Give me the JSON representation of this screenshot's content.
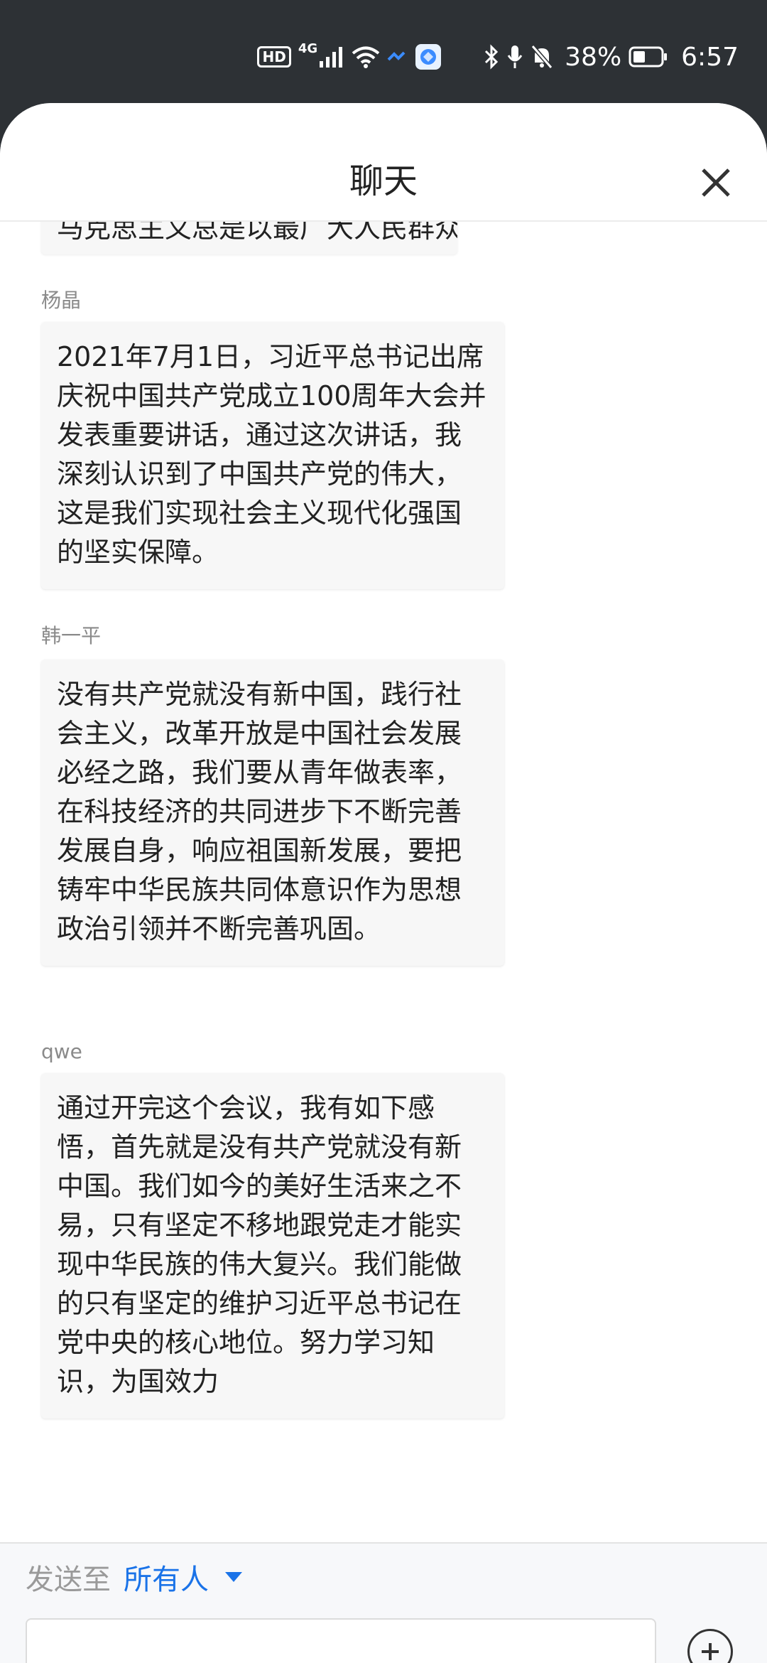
{
  "status_bar": {
    "hd": "HD",
    "network": "4G",
    "battery": "38%",
    "time": "6:57"
  },
  "header": {
    "title": "聊天"
  },
  "messages": [
    {
      "text": "马克思主义总是以最广大人民群众利益为出发点和落脚点，不断推进党的伟大事业向前发展",
      "partial": true
    },
    {
      "sender": "杨晶",
      "text": "2021年7月1日，习近平总书记出席庆祝中国共产党成立100周年大会并发表重要讲话，通过这次讲话，我深刻认识到了中国共产党的伟大，这是我们实现社会主义现代化强国的坚实保障。"
    },
    {
      "sender": "韩一平",
      "text": "没有共产党就没有新中国，践行社会主义，改革开放是中国社会发展必经之路，我们要从青年做表率，在科技经济的共同进步下不断完善发展自身，响应祖国新发展，要把铸牢中华民族共同体意识作为思想政治引领并不断完善巩固。"
    },
    {
      "sender": "qwe",
      "text": "通过开完这个会议，我有如下感悟，首先就是没有共产党就没有新中国。我们如今的美好生活来之不易，只有坚定不移地跟党走才能实现中华民族的伟大复兴。我们能做的只有坚定的维护习近平总书记在党中央的核心地位。努力学习知识，为国效力"
    }
  ],
  "composer": {
    "send_to_label": "发送至",
    "recipient": "所有人",
    "input_value": "",
    "input_placeholder": ""
  },
  "icons": {
    "close": "close-icon",
    "dropdown": "caret-down-icon",
    "add": "plus-circle-icon"
  },
  "colors": {
    "status_bar_bg": "#2d3135",
    "accent": "#1a73e8",
    "bubble_bg": "#f7f7f7"
  }
}
